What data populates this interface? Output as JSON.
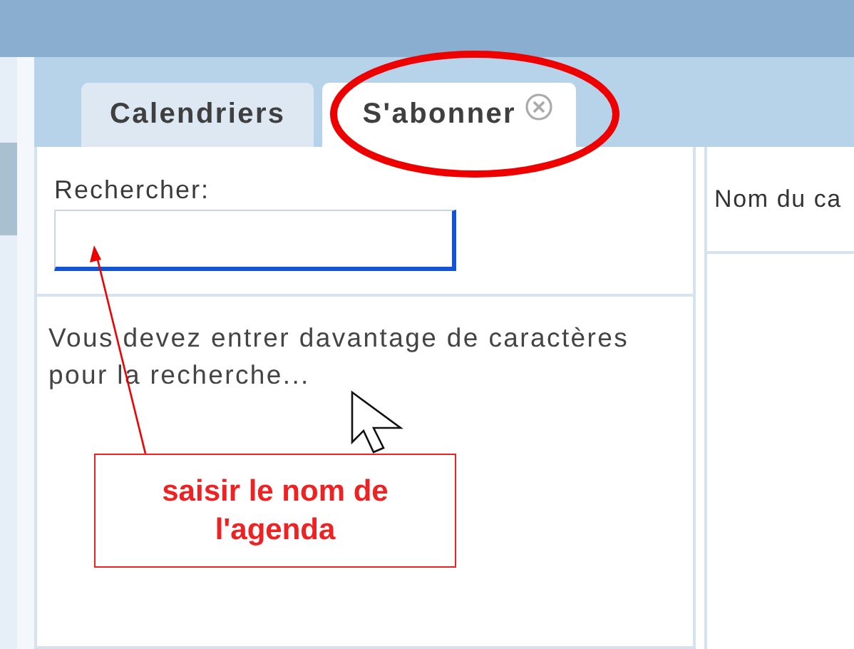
{
  "tabs": [
    {
      "label": "Calendriers",
      "selected": false,
      "closable": false
    },
    {
      "label": "S'abonner",
      "selected": true,
      "closable": true
    }
  ],
  "search": {
    "label": "Rechercher:",
    "focused": true
  },
  "message": "Vous devez entrer davantage de caractères pour la recherche...",
  "results": {
    "column_1": "Nom du ca"
  },
  "annotation": {
    "text": "saisir le nom de l'agenda"
  }
}
